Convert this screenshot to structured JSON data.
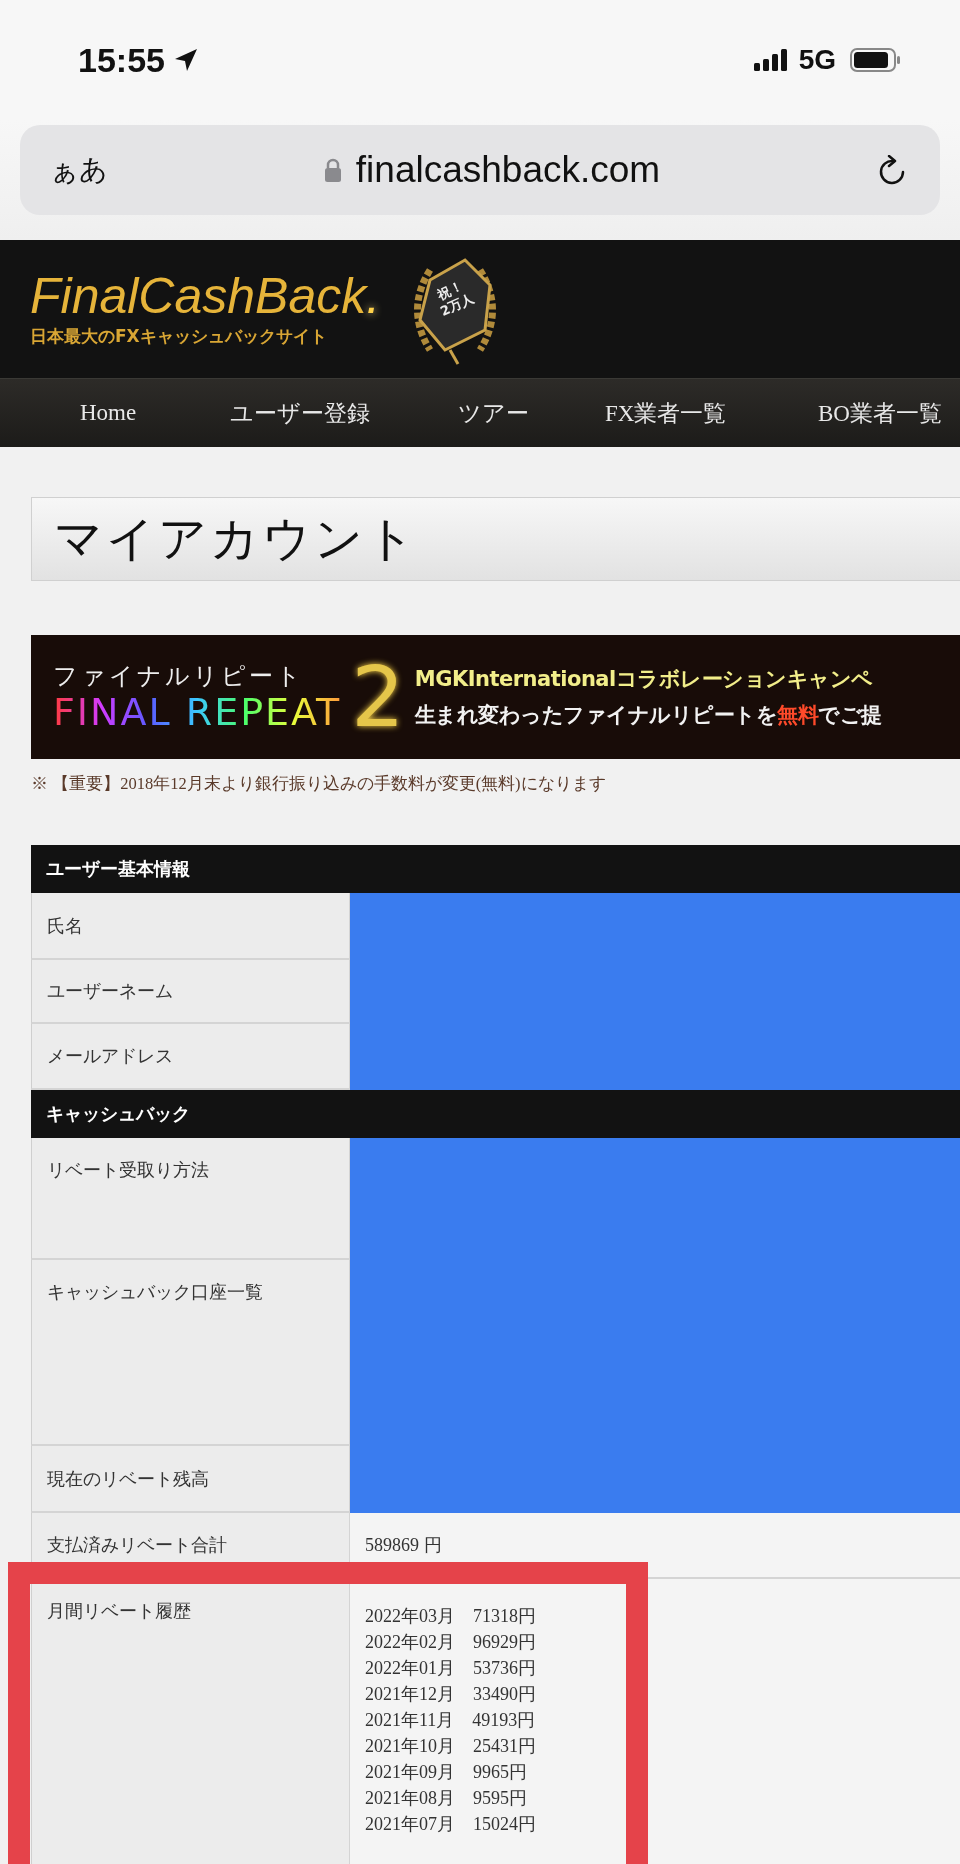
{
  "status_bar": {
    "time": "15:55",
    "network": "5G"
  },
  "address_bar": {
    "text_size_button": "ぁあ",
    "url": "finalcashback.com"
  },
  "header": {
    "logo": "FinalCashBack",
    "logo_dot": ".",
    "tagline": "日本最大のFXキャッシュバックサイト",
    "badge_top": "祝！",
    "badge_bottom": "2万人"
  },
  "nav": [
    {
      "label": "Home"
    },
    {
      "label": "ユーザー登録"
    },
    {
      "label": "ツアー"
    },
    {
      "label": "FX業者一覧"
    },
    {
      "label": "BO業者一覧"
    }
  ],
  "page_title": "マイアカウント",
  "banner": {
    "title_kana": "ファイナルリピート",
    "title_latin": "FINAL REPEAT",
    "numeral": "2",
    "line_1": "MGKInternationalコラボレーションキャンペ",
    "line_2": [
      {
        "text": "生まれ変わったファイナルリピートを",
        "highlight": false
      },
      {
        "text": "無料",
        "highlight": true
      },
      {
        "text": "でご提",
        "highlight": false
      }
    ]
  },
  "notice": "※ 【重要】2018年12月末より銀行振り込みの手数料が変更(無料)になります",
  "sections": [
    {
      "heading": "ユーザー基本情報",
      "rows": [
        {
          "label": "氏名",
          "kind": "redacted"
        },
        {
          "label": "ユーザーネーム",
          "kind": "redacted"
        },
        {
          "label": "メールアドレス",
          "kind": "redacted"
        }
      ]
    },
    {
      "heading": "キャッシュバック",
      "rows": [
        {
          "label": "リベート受取り方法",
          "kind": "redacted"
        },
        {
          "label": "キャッシュバック口座一覧",
          "kind": "redacted"
        },
        {
          "label": "現在のリベート残高",
          "kind": "redacted"
        },
        {
          "label": "支払済みリベート合計",
          "kind": "text",
          "value": "589869 円"
        },
        {
          "label": "月間リベート履歴",
          "kind": "list",
          "items": [
            "2022年03月　71318円",
            "2022年02月　96929円",
            "2022年01月　53736円",
            "2021年12月　33490円",
            "2021年11月　49193円",
            "2021年10月　25431円",
            "2021年09月　9965円",
            "2021年08月　9595円",
            "2021年07月　15024円"
          ]
        }
      ]
    }
  ]
}
